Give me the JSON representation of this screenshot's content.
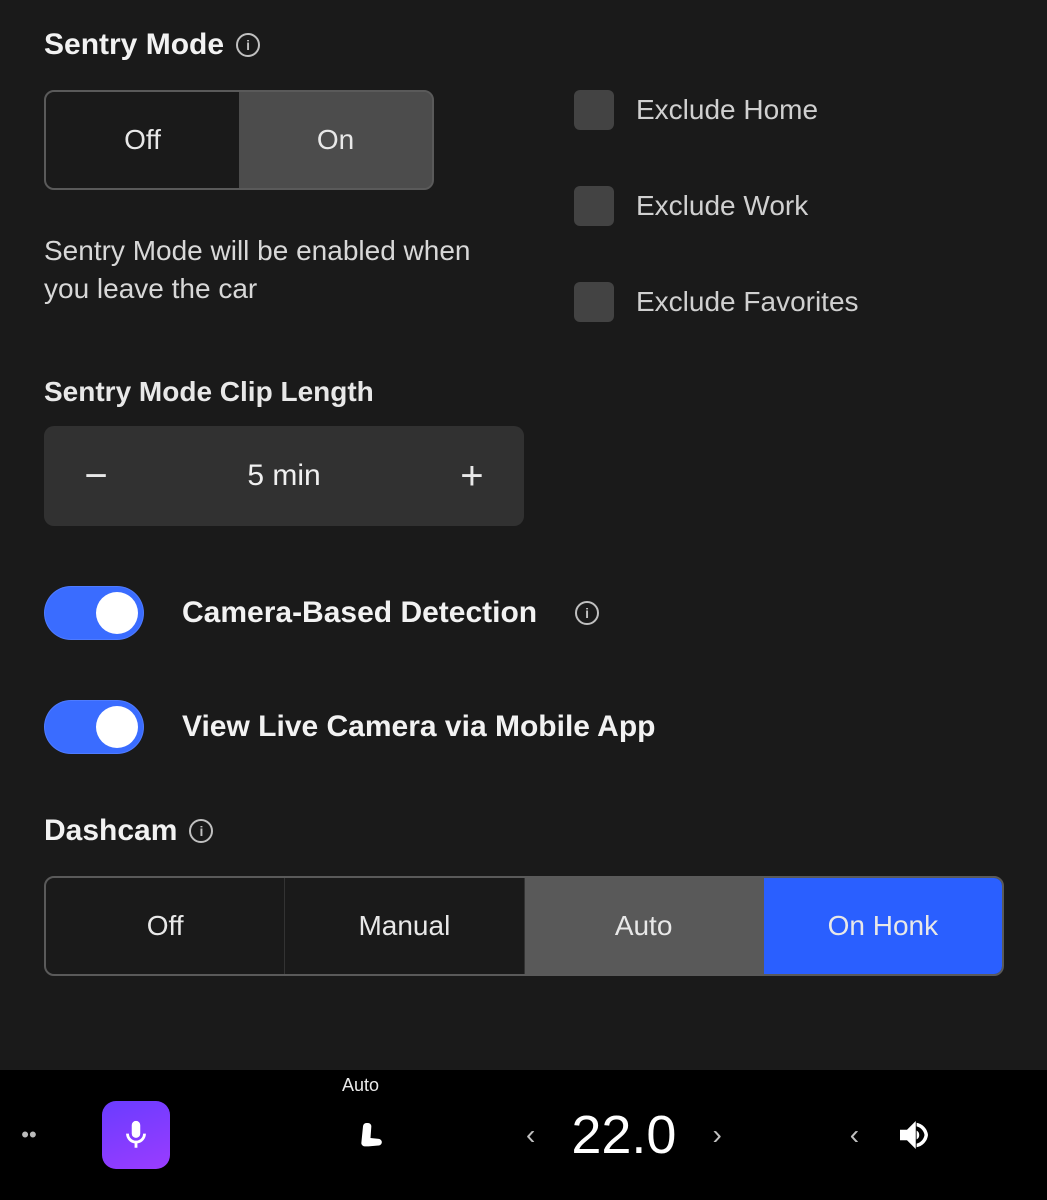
{
  "sentry": {
    "title": "Sentry Mode",
    "toggle": {
      "off": "Off",
      "on": "On",
      "active": "on"
    },
    "status": "Sentry Mode will be enabled when you leave the car",
    "exclude": {
      "home": "Exclude Home",
      "work": "Exclude Work",
      "favorites": "Exclude Favorites"
    },
    "clip": {
      "label": "Sentry Mode Clip Length",
      "value": "5 min"
    },
    "camera_detection": "Camera-Based Detection",
    "live_camera": "View Live Camera via Mobile App"
  },
  "dashcam": {
    "title": "Dashcam",
    "options": {
      "off": "Off",
      "manual": "Manual",
      "auto": "Auto",
      "onhonk": "On Honk"
    }
  },
  "bottombar": {
    "seat_mode": "Auto",
    "temperature": "22.0"
  }
}
